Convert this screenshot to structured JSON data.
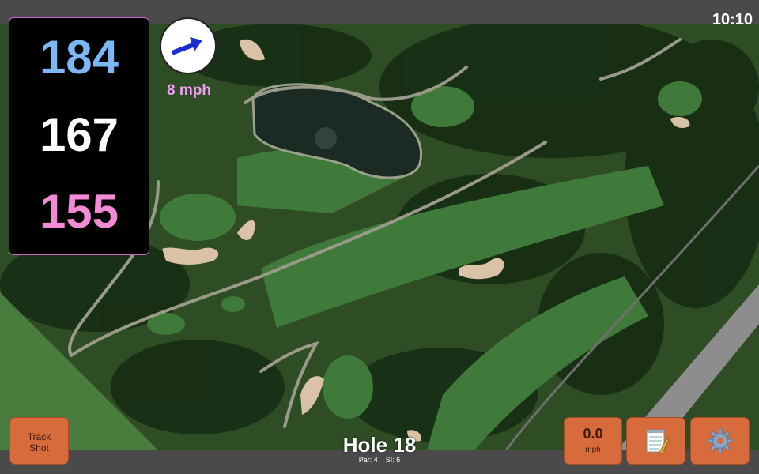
{
  "status": {
    "time": "10:10"
  },
  "distances": {
    "back": "184",
    "middle": "167",
    "front": "155"
  },
  "distance_colors": {
    "back": "#7cb8f5",
    "middle": "#ffffff",
    "front": "#f38ad6"
  },
  "wind": {
    "speed_label": "8 mph",
    "arrow_icon": "wind-arrow-icon"
  },
  "buttons": {
    "track_shot_line1": "Track",
    "track_shot_line2": "Shot",
    "wind_value": "0.0",
    "wind_unit": "mph",
    "notes_icon": "notepad-icon",
    "settings_icon": "gear-icon"
  },
  "hole": {
    "title": "Hole 18",
    "par_label": "Par: 4",
    "si_label": "SI: 6"
  },
  "colors": {
    "accent_button": "#d86b3b",
    "panel": "#000000",
    "bars": "#4a4a4a"
  }
}
